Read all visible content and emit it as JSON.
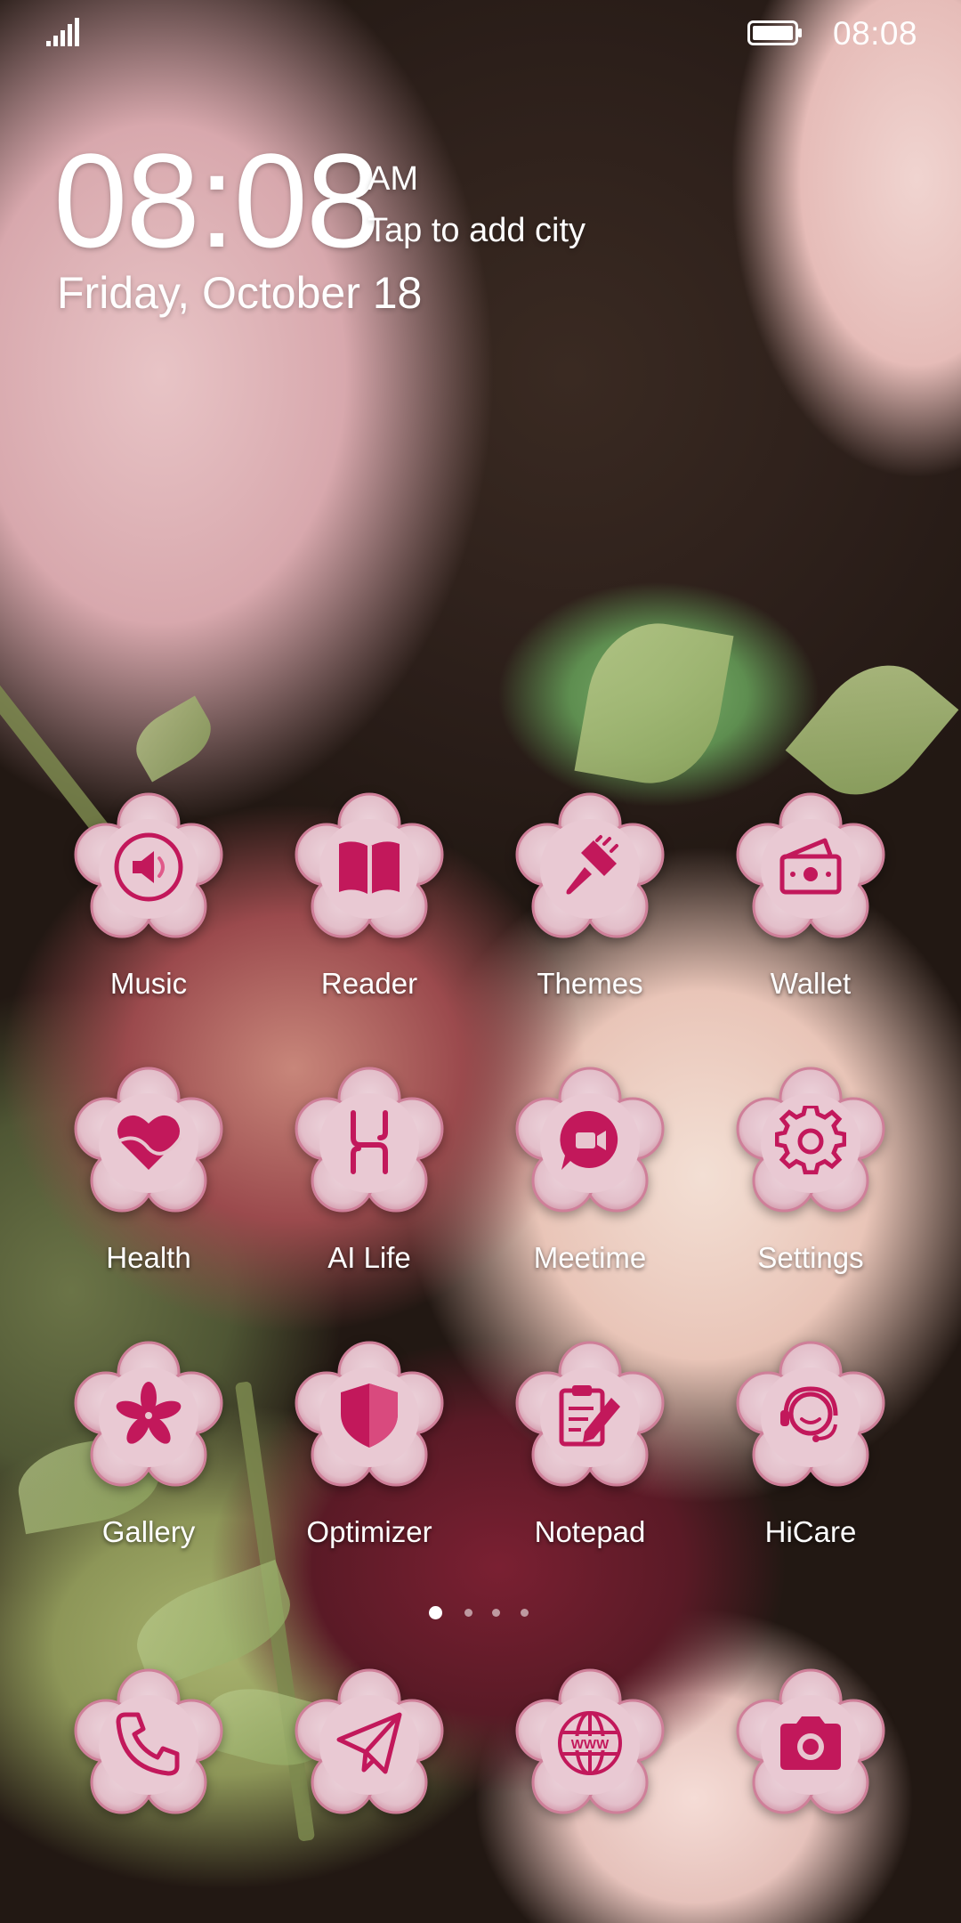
{
  "status_bar": {
    "time": "08:08",
    "signal_icon": "signal-bars-icon",
    "battery_icon": "battery-icon"
  },
  "clock": {
    "time": "08:08",
    "ampm": "AM",
    "city": "Tap to add city",
    "date": "Friday, October 18"
  },
  "theme": {
    "icon_bg": "#e8c5cf",
    "icon_rim": "#d49aab",
    "glyph": "#c2185b",
    "glyph_light": "#e05a8a"
  },
  "apps": [
    {
      "label": "Music",
      "icon": "speaker-icon"
    },
    {
      "label": "Reader",
      "icon": "book-icon"
    },
    {
      "label": "Themes",
      "icon": "paintbrush-icon"
    },
    {
      "label": "Wallet",
      "icon": "wallet-icon"
    },
    {
      "label": "Health",
      "icon": "heart-icon"
    },
    {
      "label": "AI Life",
      "icon": "ai-life-icon"
    },
    {
      "label": "Meetime",
      "icon": "video-chat-icon"
    },
    {
      "label": "Settings",
      "icon": "gear-icon"
    },
    {
      "label": "Gallery",
      "icon": "flower-icon"
    },
    {
      "label": "Optimizer",
      "icon": "shield-icon"
    },
    {
      "label": "Notepad",
      "icon": "notepad-icon"
    },
    {
      "label": "HiCare",
      "icon": "headset-icon"
    }
  ],
  "pager": {
    "pages": 4,
    "active": 1
  },
  "dock": [
    {
      "icon": "phone-icon"
    },
    {
      "icon": "paper-plane-icon"
    },
    {
      "icon": "web-browser-icon"
    },
    {
      "icon": "camera-icon"
    }
  ]
}
